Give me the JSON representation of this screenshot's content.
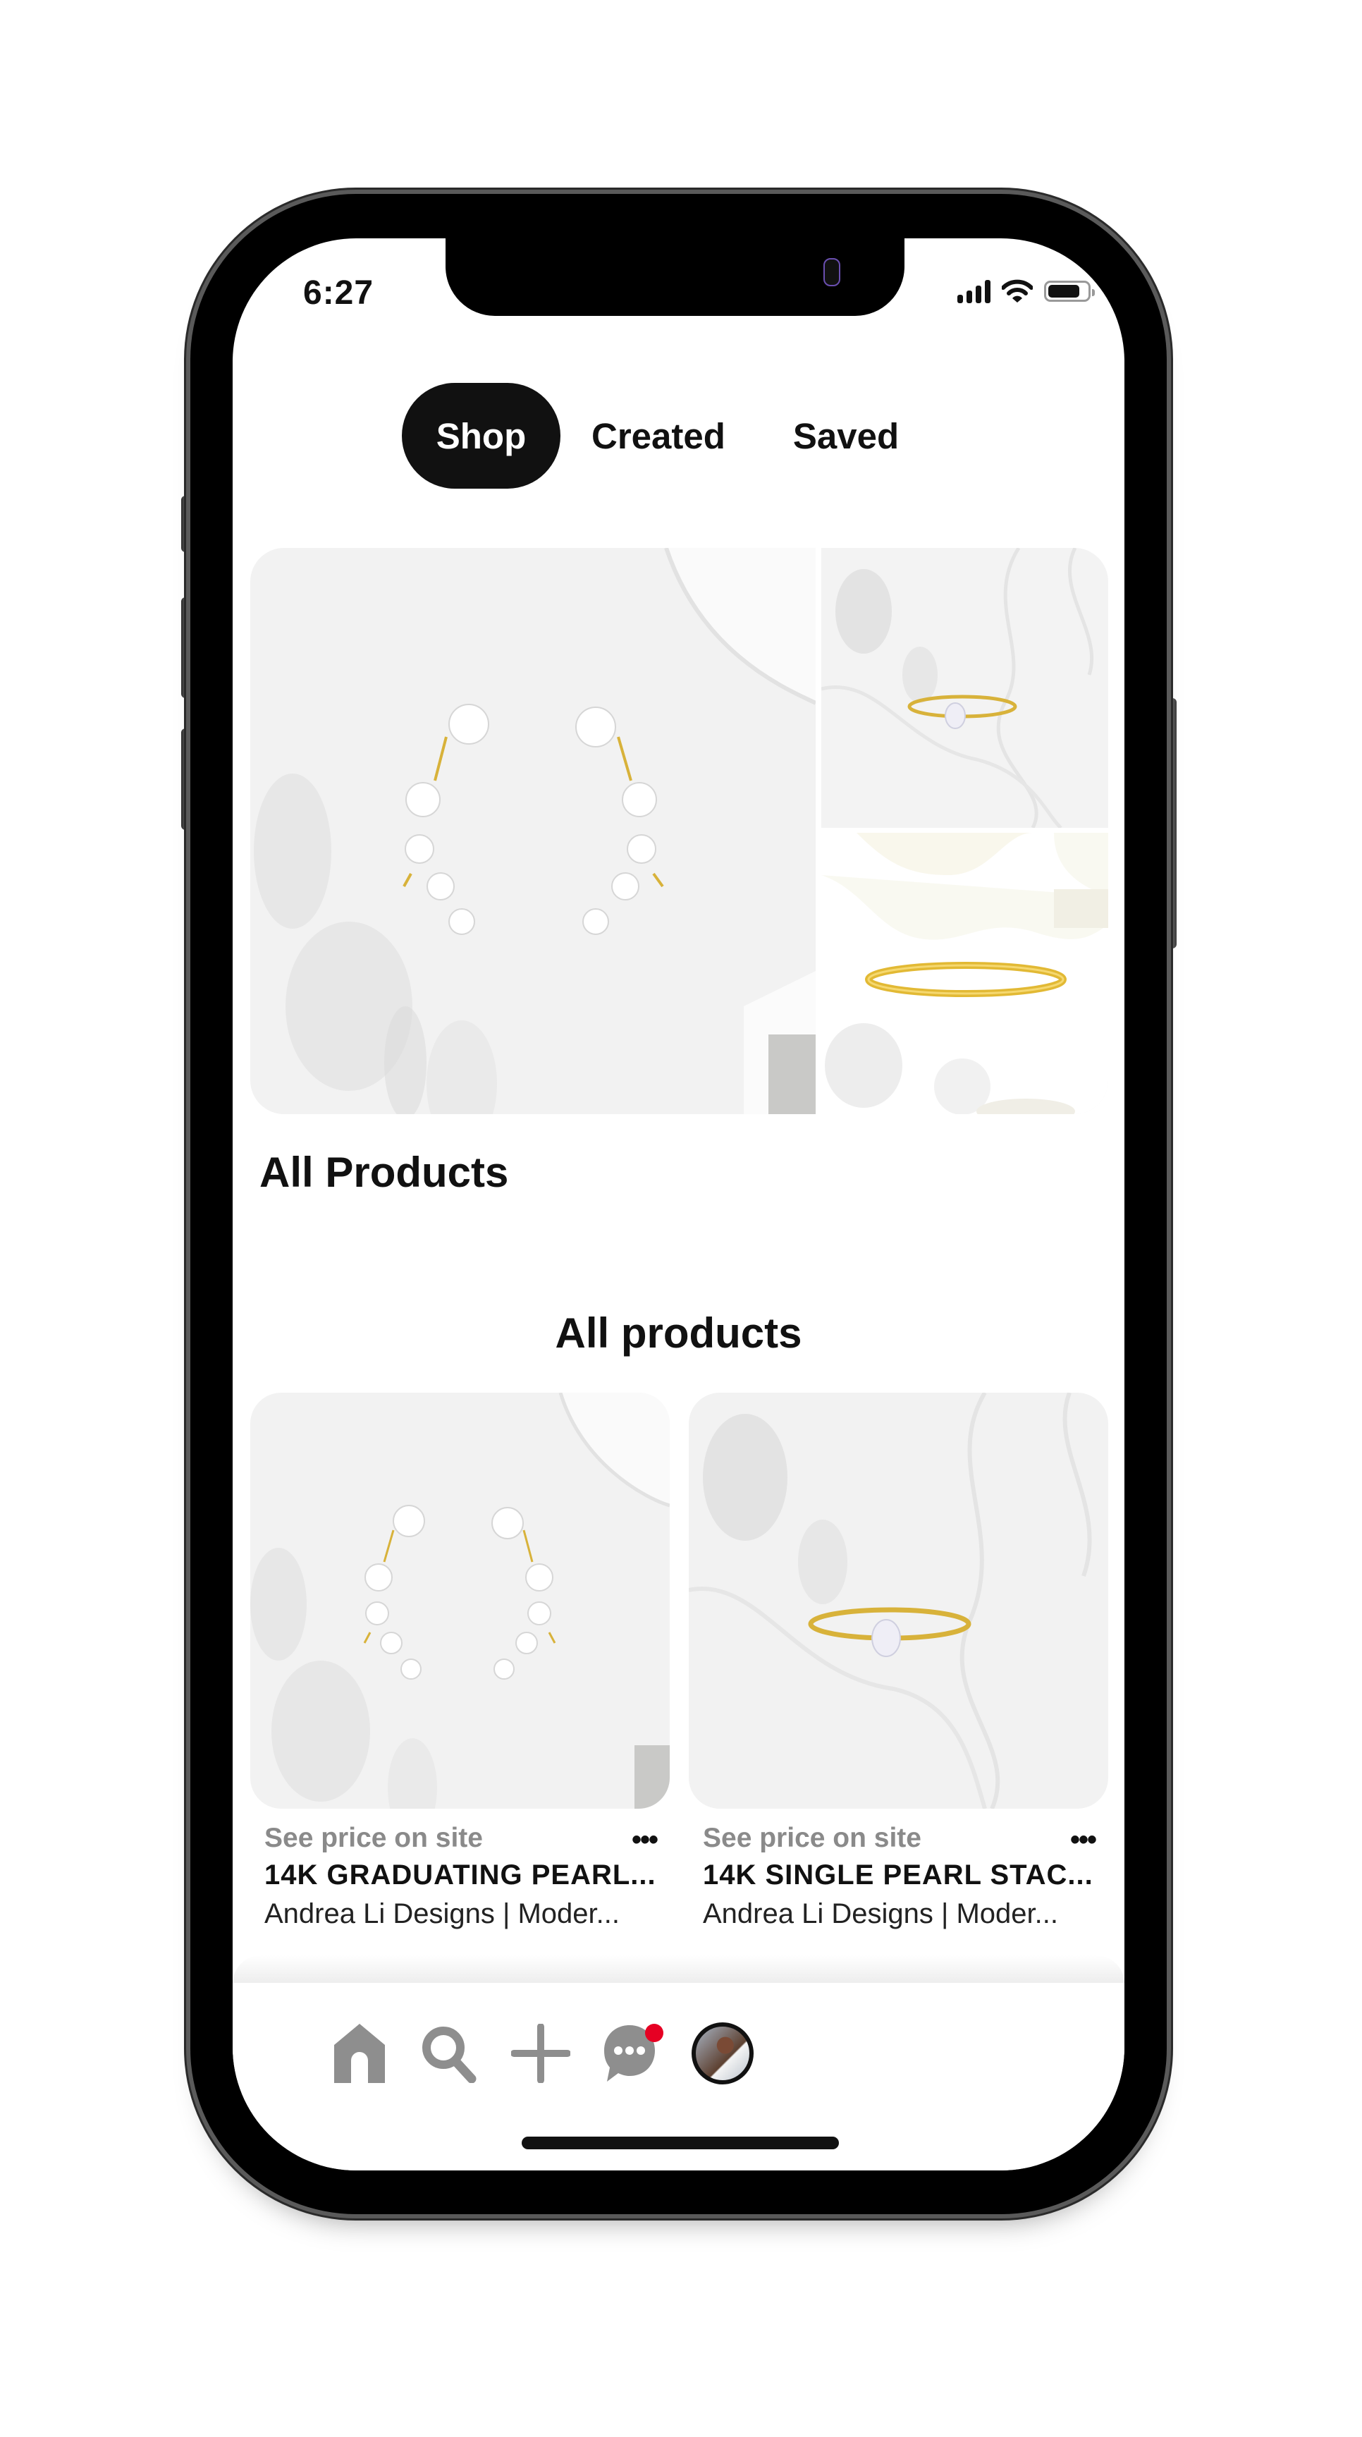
{
  "status_bar": {
    "time": "6:27",
    "icons": [
      "cellular-signal-icon",
      "wifi-icon",
      "battery-icon"
    ]
  },
  "tabs": [
    {
      "label": "Shop",
      "active": true
    },
    {
      "label": "Created",
      "active": false
    },
    {
      "label": "Saved",
      "active": false
    }
  ],
  "hero_collage": {
    "images": [
      {
        "name": "graduating-pearl-earrings-image",
        "description": "Pearl ear climber earrings"
      },
      {
        "name": "single-pearl-ring-image",
        "description": "Gold ring with single pearl"
      },
      {
        "name": "gold-bangle-image",
        "description": "Gold hammered bangle"
      }
    ]
  },
  "collection": {
    "title": "All Products"
  },
  "section": {
    "title": "All products"
  },
  "products": [
    {
      "price": "See price on site",
      "title": "14K GRADUATING PEARL...",
      "brand": "Andrea Li Designs | Moder...",
      "more_label": "•••"
    },
    {
      "price": "See price on site",
      "title": "14K SINGLE PEARL STAC...",
      "brand": "Andrea Li Designs | Moder...",
      "more_label": "•••"
    }
  ],
  "bottom_nav": {
    "items": [
      {
        "name": "home",
        "icon": "home-icon"
      },
      {
        "name": "search",
        "icon": "search-icon"
      },
      {
        "name": "create",
        "icon": "plus-icon"
      },
      {
        "name": "messages",
        "icon": "chat-bubble-icon",
        "has_notification": true
      },
      {
        "name": "profile",
        "icon": "avatar"
      }
    ]
  },
  "colors": {
    "accent_notification": "#e60023",
    "active_tab_bg": "#111111",
    "nav_icon": "#8e8e8e",
    "price_text": "#8a8a8a"
  }
}
